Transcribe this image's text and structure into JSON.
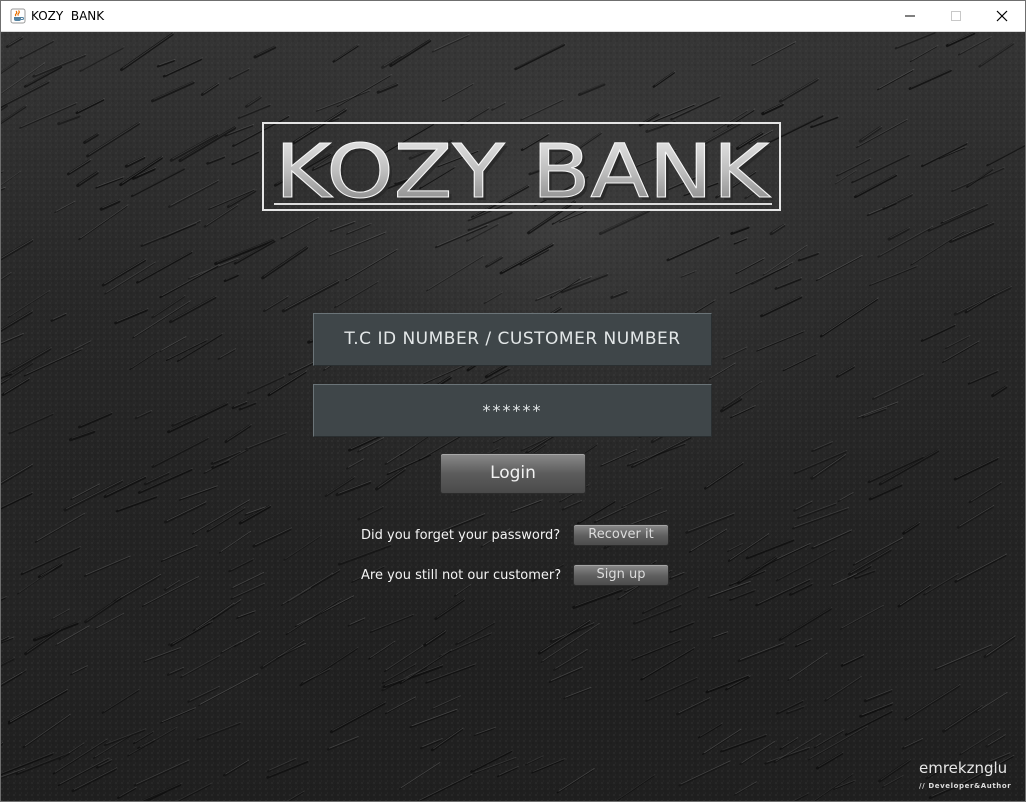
{
  "window": {
    "title": "KOZY  BANK",
    "app_icon": "java-cup-icon"
  },
  "logo": {
    "text": "KOZY BANK"
  },
  "login_form": {
    "id_field_value": "T.C ID NUMBER / CUSTOMER NUMBER",
    "password_field_value": "******",
    "login_label": "Login"
  },
  "recover": {
    "question": "Did you forget your password?",
    "button_label": "Recover it"
  },
  "signup": {
    "question": "Are you still not our customer?",
    "button_label": "Sign up"
  },
  "footer": {
    "author": "emrekznglu",
    "role": "// Developer&Author"
  },
  "colors": {
    "background": "#272727",
    "field": "#3f4649",
    "button": "#5c5c5c"
  }
}
